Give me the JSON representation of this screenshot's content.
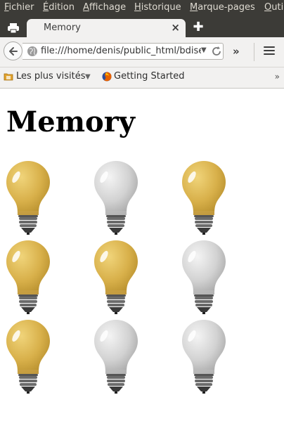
{
  "menu": [
    "Fichier",
    "Édition",
    "Affichage",
    "Historique",
    "Marque-pages",
    "Outils"
  ],
  "tab": {
    "title": "Memory",
    "close_symbol": "×"
  },
  "new_tab_symbol": "✚",
  "nav": {
    "url": "file:///home/denis/public_html/bdise",
    "overflow_symbol": "»"
  },
  "bookmarks": {
    "most_visited": "Les plus visités",
    "getting_started": "Getting Started",
    "more_symbol": "»"
  },
  "page": {
    "title": "Memory"
  },
  "bulbs": [
    {
      "state": "on"
    },
    {
      "state": "off"
    },
    {
      "state": "on"
    },
    {
      "state": "on"
    },
    {
      "state": "on"
    },
    {
      "state": "off"
    },
    {
      "state": "on"
    },
    {
      "state": "off"
    },
    {
      "state": "off"
    }
  ],
  "colors": {
    "bulb_on": "#d8b04a",
    "bulb_off": "#d2d2d2",
    "chrome_dark": "#3c3b37",
    "chrome_light": "#f2f1f0"
  }
}
